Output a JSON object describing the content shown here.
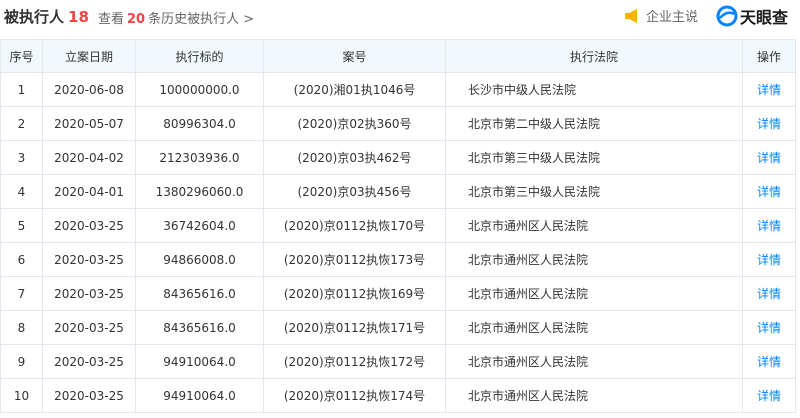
{
  "header": {
    "title": "被执行人",
    "count": "18",
    "history_prefix": "查看",
    "history_count": "20",
    "history_suffix": "条历史被执行人 >",
    "owner_label": "企业主说",
    "brand_label": "天眼查"
  },
  "colors": {
    "accent": "#0084ff",
    "highlight": "#f04545",
    "header_bg": "#f2f9fc",
    "owner_icon": "#f5b400"
  },
  "icons": {
    "owner": "megaphone-icon",
    "brand": "tianyancha-logo-icon"
  },
  "table": {
    "columns": [
      "序号",
      "立案日期",
      "执行标的",
      "案号",
      "执行法院",
      "操作"
    ],
    "rows": [
      {
        "no": "1",
        "date": "2020-06-08",
        "amount": "100000000.0",
        "case": "(2020)湘01执1046号",
        "court": "长沙市中级人民法院",
        "action": "详情"
      },
      {
        "no": "2",
        "date": "2020-05-07",
        "amount": "80996304.0",
        "case": "(2020)京02执360号",
        "court": "北京市第二中级人民法院",
        "action": "详情"
      },
      {
        "no": "3",
        "date": "2020-04-02",
        "amount": "212303936.0",
        "case": "(2020)京03执462号",
        "court": "北京市第三中级人民法院",
        "action": "详情"
      },
      {
        "no": "4",
        "date": "2020-04-01",
        "amount": "1380296060.0",
        "case": "(2020)京03执456号",
        "court": "北京市第三中级人民法院",
        "action": "详情"
      },
      {
        "no": "5",
        "date": "2020-03-25",
        "amount": "36742604.0",
        "case": "(2020)京0112执恢170号",
        "court": "北京市通州区人民法院",
        "action": "详情"
      },
      {
        "no": "6",
        "date": "2020-03-25",
        "amount": "94866008.0",
        "case": "(2020)京0112执恢173号",
        "court": "北京市通州区人民法院",
        "action": "详情"
      },
      {
        "no": "7",
        "date": "2020-03-25",
        "amount": "84365616.0",
        "case": "(2020)京0112执恢169号",
        "court": "北京市通州区人民法院",
        "action": "详情"
      },
      {
        "no": "8",
        "date": "2020-03-25",
        "amount": "84365616.0",
        "case": "(2020)京0112执恢171号",
        "court": "北京市通州区人民法院",
        "action": "详情"
      },
      {
        "no": "9",
        "date": "2020-03-25",
        "amount": "94910064.0",
        "case": "(2020)京0112执恢172号",
        "court": "北京市通州区人民法院",
        "action": "详情"
      },
      {
        "no": "10",
        "date": "2020-03-25",
        "amount": "94910064.0",
        "case": "(2020)京0112执恢174号",
        "court": "北京市通州区人民法院",
        "action": "详情"
      }
    ]
  }
}
